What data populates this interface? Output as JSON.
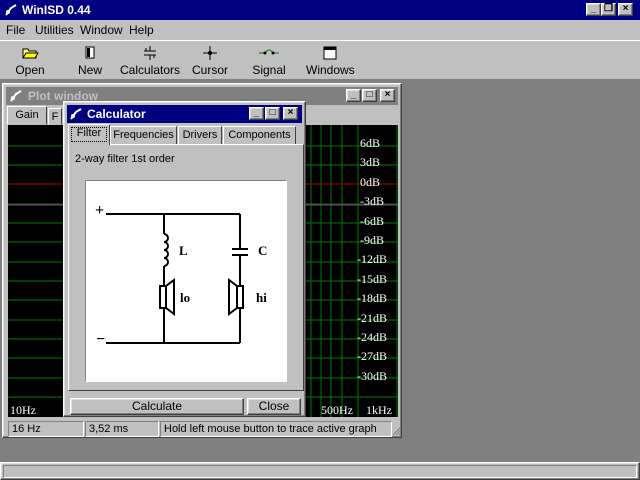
{
  "app": {
    "title": "WinISD 0.44"
  },
  "menu": [
    "File",
    "Utilities",
    "Window",
    "Help"
  ],
  "toolbar": {
    "open": "Open",
    "new": "New",
    "calculators": "Calculators",
    "cursor": "Cursor",
    "signal_gen": "Signal gen.",
    "windows": "Windows"
  },
  "plot_window": {
    "title": "Plot window",
    "tabs": [
      "Gain",
      "F"
    ],
    "y_ticks": [
      "6dB",
      "3dB",
      "0dB",
      "-3dB",
      "-6dB",
      "-9dB",
      "-12dB",
      "-15dB",
      "-18dB",
      "-21dB",
      "-24dB",
      "-27dB",
      "-30dB"
    ],
    "x_ticks": [
      "10Hz",
      "500Hz",
      "1kHz"
    ],
    "status": {
      "freq": "16 Hz",
      "time": "3,52 ms",
      "hint": "Hold left mouse button to trace active graph"
    }
  },
  "calculator": {
    "title": "Calculator",
    "tabs": [
      "Filter",
      "Frequencies",
      "Drivers",
      "Components"
    ],
    "active_tab": "Filter",
    "filter_label": "2-way filter 1st order",
    "diagram": {
      "plus": "+",
      "minus": "−",
      "inductor": "L",
      "capacitor": "C",
      "low_driver": "lo",
      "high_driver": "hi"
    },
    "calculate_button": "Calculate",
    "close_button": "Close"
  },
  "colors": {
    "title_active": "#000080",
    "title_inactive": "#808080",
    "grid": "#007a00",
    "zero_line": "#b00000",
    "face": "#c0c0c0"
  }
}
